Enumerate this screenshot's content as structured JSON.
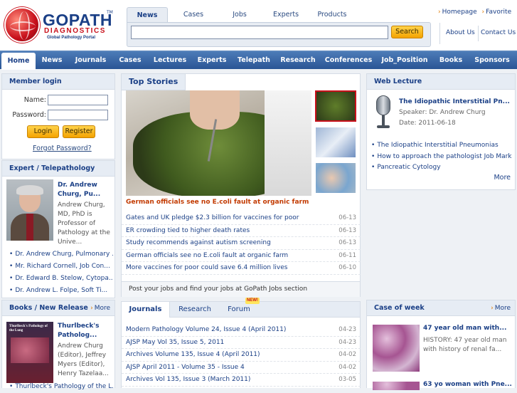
{
  "brand": {
    "name": "GOPATH",
    "tm": "TM",
    "sub": "DIAGNOSTICS",
    "tagline": "Global Pathology Portal"
  },
  "search": {
    "tabs": [
      "News",
      "Cases",
      "Jobs",
      "Experts",
      "Products"
    ],
    "active_tab": "News",
    "query": "",
    "button": "Search"
  },
  "util": {
    "homepage": "Homepage",
    "favorite": "Favorite",
    "about": "About Us",
    "contact": "Contact Us"
  },
  "nav": [
    "Home",
    "News",
    "Journals",
    "Cases",
    "Lectures",
    "Experts",
    "Telepath",
    "Research",
    "Conferences",
    "Job_Position",
    "Books",
    "Sponsors"
  ],
  "login": {
    "title": "Member login",
    "name_label": "Name:",
    "password_label": "Password:",
    "login_btn": "Login",
    "register_btn": "Register",
    "forgot": "Forgot Password?"
  },
  "expert": {
    "title": "Expert / Telepathology",
    "featured_name": "Dr. Andrew Churg, Pu...",
    "featured_desc": "Andrew Churg, MD, PhD is Professor of Pathology at the Unive...",
    "list": [
      "Dr. Andrew Churg, Pulmonary ...",
      "Mr. Richard Cornell, Job Con...",
      "Dr. Edward B. Stelow, Cytopa...",
      "Dr. Andrew L. Folpe, Soft Ti..."
    ]
  },
  "books": {
    "title": "Books / New Release",
    "more": "More",
    "featured_title": "Thurlbeck's Patholog...",
    "featured_desc": "Andrew Churg (Editor), Jeffrey Myers (Editor), Henry Tazelaa...",
    "cover_text": "Thurlbeck's Pathology of the Lung",
    "list": [
      "Thurlbeck's Pathology of the L..."
    ]
  },
  "top_stories": {
    "title": "Top Stories",
    "caption": "German officials see no E.coli fault at organic farm",
    "items": [
      {
        "text": "Gates and UK pledge $2.3 billion for vaccines for poor",
        "date": "06-13"
      },
      {
        "text": "ER crowding tied to higher death rates",
        "date": "06-13"
      },
      {
        "text": "Study recommends against autism screening",
        "date": "06-13"
      },
      {
        "text": "German officials see no E.coli fault at organic farm",
        "date": "06-11"
      },
      {
        "text": "More vaccines for poor could save 6.4 million lives",
        "date": "06-10"
      }
    ],
    "jobs_banner": "Post your jobs and find your jobs at GoPath Jobs section"
  },
  "journals": {
    "tabs": [
      "Journals",
      "Research",
      "Forum"
    ],
    "new_badge": "NEW!",
    "items": [
      {
        "text": "Modern Pathology Volume 24, Issue 4 (April 2011)",
        "date": "04-23"
      },
      {
        "text": "AJSP May Vol 35, Issue 5, 2011",
        "date": "04-23"
      },
      {
        "text": "Archives Volume 135, Issue 4 (April 2011)",
        "date": "04-02"
      },
      {
        "text": "AJSP April 2011 - Volume 35 - Issue 4",
        "date": "04-02"
      },
      {
        "text": "Archives Vol 135, Issue 3 (March 2011)",
        "date": "03-05"
      }
    ]
  },
  "web_lecture": {
    "title": "Web Lecture",
    "featured_title": "The Idiopathic Interstitial Pn...",
    "speaker": "Speaker: Dr. Andrew Churg",
    "date": "Date: 2011-06-18",
    "list": [
      "The Idiopathic Interstitial Pneumonias",
      "How to approach the pathologist Job Mark",
      "Pancreatic Cytology"
    ],
    "more": "More"
  },
  "case_of_week": {
    "title": "Case of week",
    "more": "More",
    "case1_title": "47 year old man with...",
    "case1_desc": "HISTORY: 47 year old man with history of renal fa...",
    "case2_title": "63 yo woman with Pne..."
  },
  "colors": {
    "brand_blue": "#1a3f86",
    "brand_red": "#c8101b",
    "accent_orange": "#f4a200",
    "nav_blue": "#2a5595"
  }
}
